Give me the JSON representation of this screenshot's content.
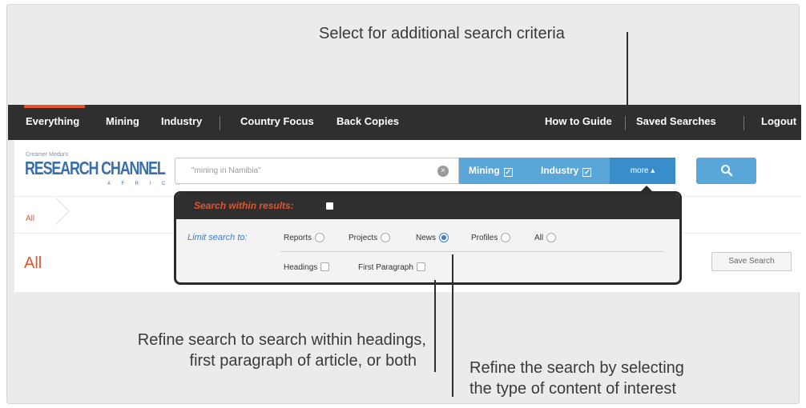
{
  "annotations": {
    "top": "Select for additional search criteria",
    "left_line1": "Refine search to search within headings,",
    "left_line2": "first paragraph of article, or both",
    "right_line1": "Refine the search by selecting",
    "right_line2": "the type of content of interest"
  },
  "nav": {
    "left": [
      "Everything",
      "Mining",
      "Industry",
      "Country Focus",
      "Back Copies"
    ],
    "active": "Everything",
    "right": [
      "How to Guide",
      "Saved Searches",
      "Logout"
    ]
  },
  "logo": {
    "small": "Creamer Media's",
    "main": "RESEARCH CHANNEL",
    "region": "AFRICA"
  },
  "search": {
    "value": "\"mining in Namibia\"",
    "clear_icon": "close-circle-icon",
    "filter_mining": "Mining",
    "filter_industry": "Industry",
    "more_label": "more ▴",
    "go_icon": "search-icon"
  },
  "breadcrumb": {
    "item": "All"
  },
  "page": {
    "title": "All",
    "save_button": "Save Search"
  },
  "dropdown": {
    "within_results": "Search within results:",
    "limit_label": "Limit search to:",
    "types": [
      {
        "label": "Reports",
        "selected": false
      },
      {
        "label": "Projects",
        "selected": false
      },
      {
        "label": "News",
        "selected": true
      },
      {
        "label": "Profiles",
        "selected": false
      },
      {
        "label": "All",
        "selected": false
      }
    ],
    "scope": [
      {
        "label": "Headings",
        "checked": false
      },
      {
        "label": "First Paragraph",
        "checked": false
      }
    ]
  },
  "colors": {
    "accent": "#e4532c",
    "nav_bg": "#2f2f2f",
    "filter_blue": "#5ba6d8",
    "more_blue": "#3a8dcb",
    "label_blue": "#3c7dc4"
  }
}
